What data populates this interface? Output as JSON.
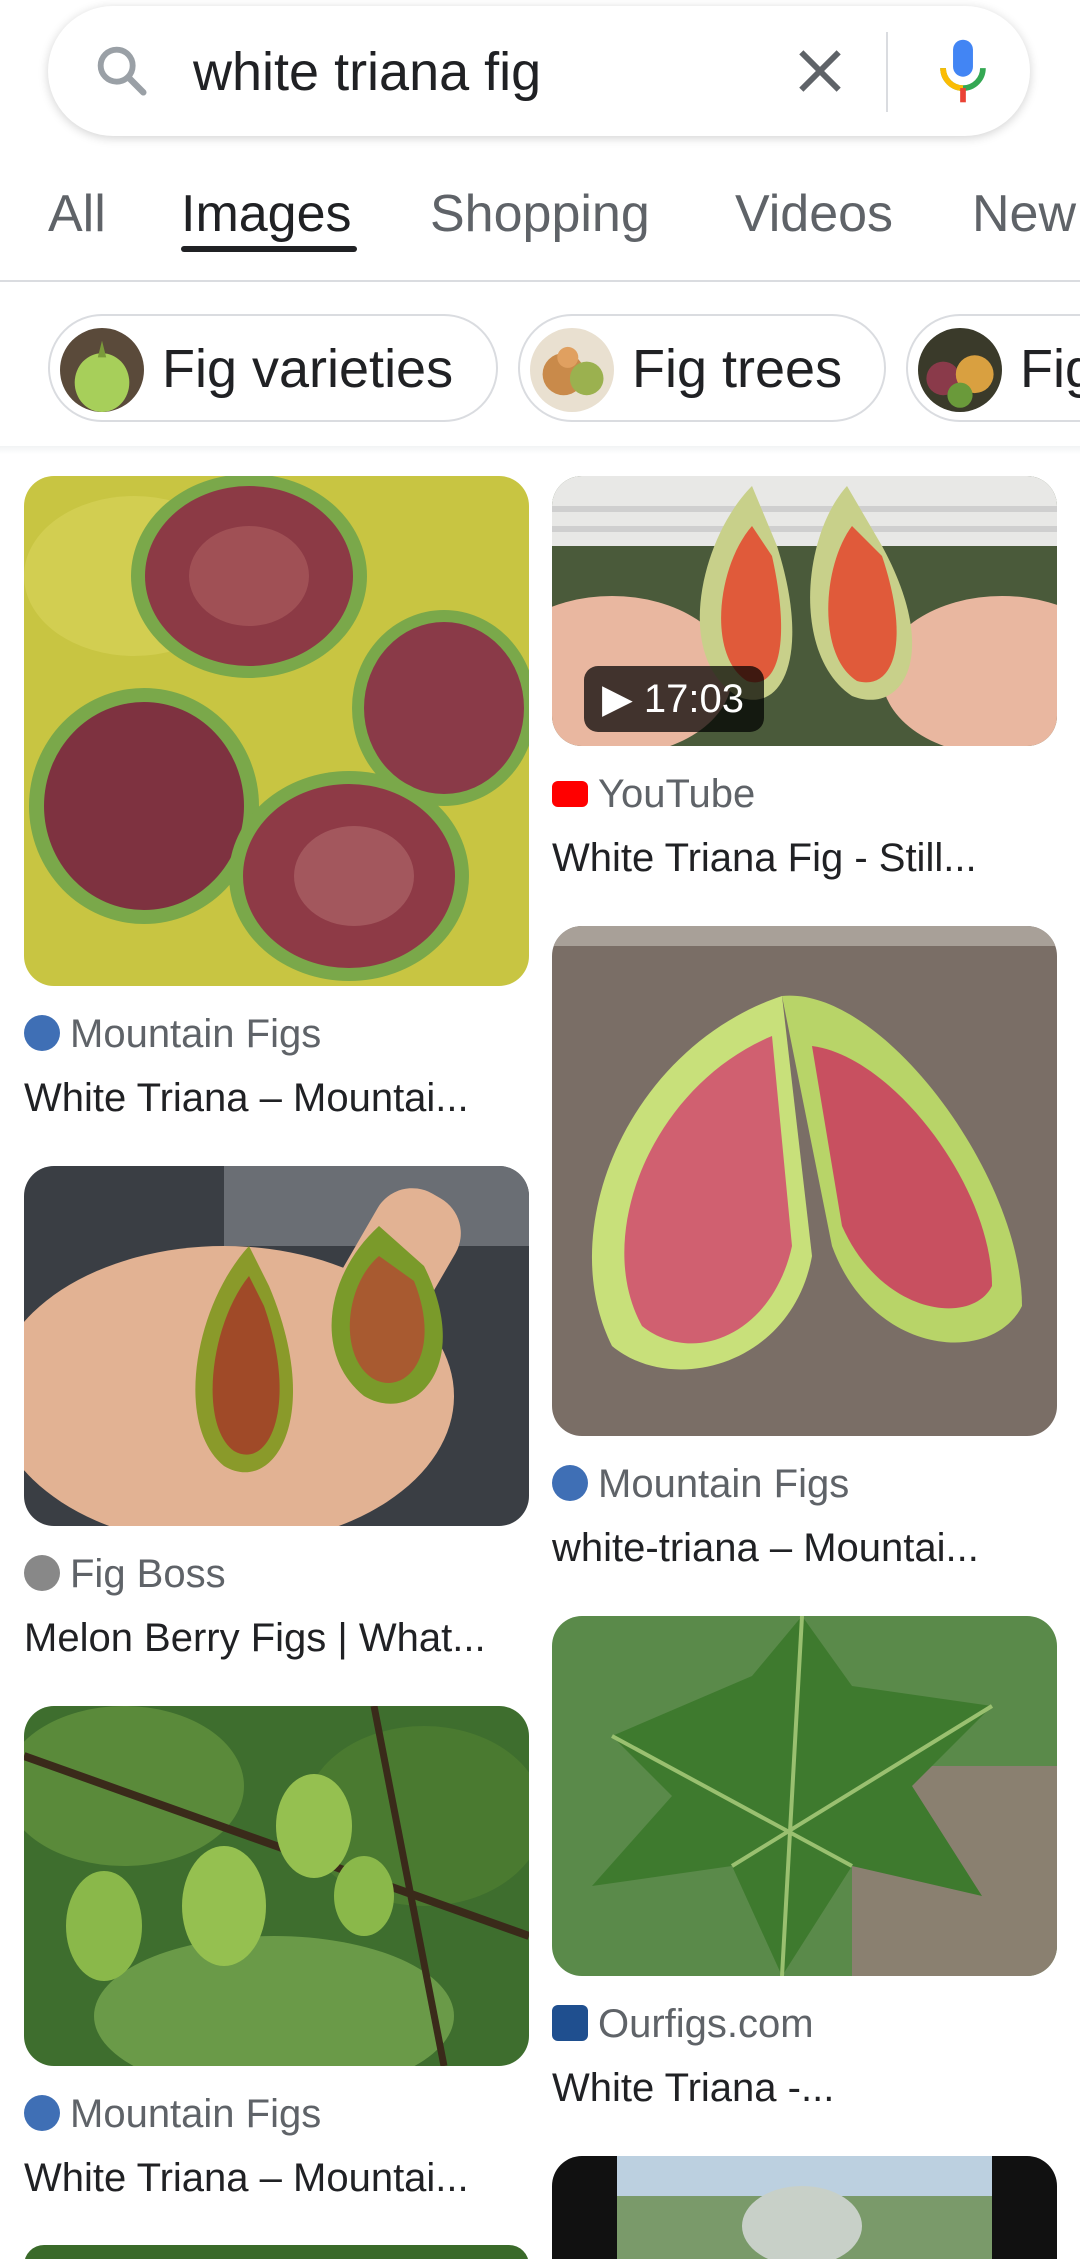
{
  "search": {
    "query": "white triana fig"
  },
  "tabs": [
    {
      "label": "All"
    },
    {
      "label": "Images",
      "active": true
    },
    {
      "label": "Shopping"
    },
    {
      "label": "Videos"
    },
    {
      "label": "New"
    }
  ],
  "chips": [
    {
      "label": "Fig varieties"
    },
    {
      "label": "Fig trees"
    },
    {
      "label": "Fig"
    }
  ],
  "results": [
    {
      "source": "Mountain Figs",
      "title": "White Triana – Mountai...",
      "favicon": "wordpress-icon"
    },
    {
      "source": "YouTube",
      "title": "White Triana Fig - Still...",
      "favicon": "youtube-icon",
      "duration": "17:03"
    },
    {
      "source": "Fig Boss",
      "title": "Melon Berry Figs | What...",
      "favicon": "figboss-icon"
    },
    {
      "source": "Mountain Figs",
      "title": "white-triana – Mountai...",
      "favicon": "wordpress-icon"
    },
    {
      "source": "Mountain Figs",
      "title": "White Triana – Mountai...",
      "favicon": "wordpress-icon"
    },
    {
      "source": "Ourfigs.com",
      "title": "White Triana -...",
      "favicon": "ourfigs-icon"
    }
  ],
  "colors": {
    "accent": "#1a73e8",
    "text": "#202124",
    "muted": "#5f6368",
    "border": "#dadce0"
  }
}
